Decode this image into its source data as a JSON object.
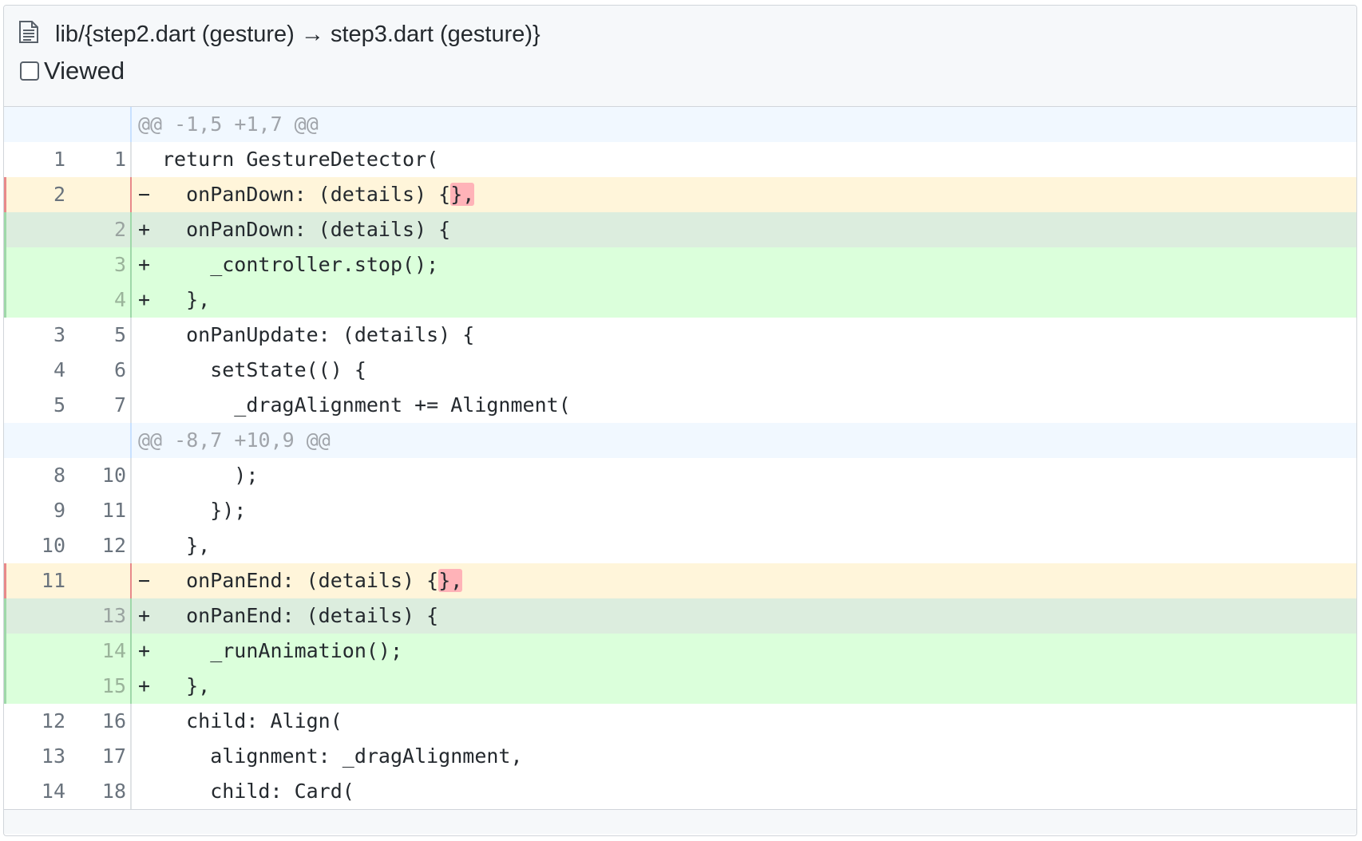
{
  "file": {
    "path": "lib/{step2.dart (gesture) → step3.dart (gesture)}",
    "viewed_label": "Viewed"
  },
  "diff": [
    {
      "type": "hunk",
      "old": "",
      "new": "",
      "marker": "",
      "text": "@@ -1,5 +1,7 @@"
    },
    {
      "type": "context",
      "old": "1",
      "new": "1",
      "marker": "",
      "text": "return GestureDetector("
    },
    {
      "type": "del",
      "old": "2",
      "new": "",
      "marker": "−",
      "text": "  onPanDown: (details) {",
      "highlight": "},"
    },
    {
      "type": "add-mod",
      "old": "",
      "new": "2",
      "marker": "+",
      "text": "  onPanDown: (details) {"
    },
    {
      "type": "add",
      "old": "",
      "new": "3",
      "marker": "+",
      "text": "    _controller.stop();"
    },
    {
      "type": "add",
      "old": "",
      "new": "4",
      "marker": "+",
      "text": "  },"
    },
    {
      "type": "context",
      "old": "3",
      "new": "5",
      "marker": "",
      "text": "  onPanUpdate: (details) {"
    },
    {
      "type": "context",
      "old": "4",
      "new": "6",
      "marker": "",
      "text": "    setState(() {"
    },
    {
      "type": "context",
      "old": "5",
      "new": "7",
      "marker": "",
      "text": "      _dragAlignment += Alignment("
    },
    {
      "type": "hunk",
      "old": "",
      "new": "",
      "marker": "",
      "text": "@@ -8,7 +10,9 @@"
    },
    {
      "type": "context",
      "old": "8",
      "new": "10",
      "marker": "",
      "text": "      );"
    },
    {
      "type": "context",
      "old": "9",
      "new": "11",
      "marker": "",
      "text": "    });"
    },
    {
      "type": "context",
      "old": "10",
      "new": "12",
      "marker": "",
      "text": "  },"
    },
    {
      "type": "del",
      "old": "11",
      "new": "",
      "marker": "−",
      "text": "  onPanEnd: (details) {",
      "highlight": "},"
    },
    {
      "type": "add-mod",
      "old": "",
      "new": "13",
      "marker": "+",
      "text": "  onPanEnd: (details) {"
    },
    {
      "type": "add",
      "old": "",
      "new": "14",
      "marker": "+",
      "text": "    _runAnimation();"
    },
    {
      "type": "add",
      "old": "",
      "new": "15",
      "marker": "+",
      "text": "  },"
    },
    {
      "type": "context",
      "old": "12",
      "new": "16",
      "marker": "",
      "text": "  child: Align("
    },
    {
      "type": "context",
      "old": "13",
      "new": "17",
      "marker": "",
      "text": "    alignment: _dragAlignment,"
    },
    {
      "type": "context",
      "old": "14",
      "new": "18",
      "marker": "",
      "text": "    child: Card("
    }
  ],
  "colors": {
    "deleted_bg": "#fff5da",
    "added_bg": "#dbffdb",
    "modified_added_bg": "#dcedde",
    "hunk_bg": "#f1f8ff",
    "word_highlight": "#ffb3b8"
  }
}
